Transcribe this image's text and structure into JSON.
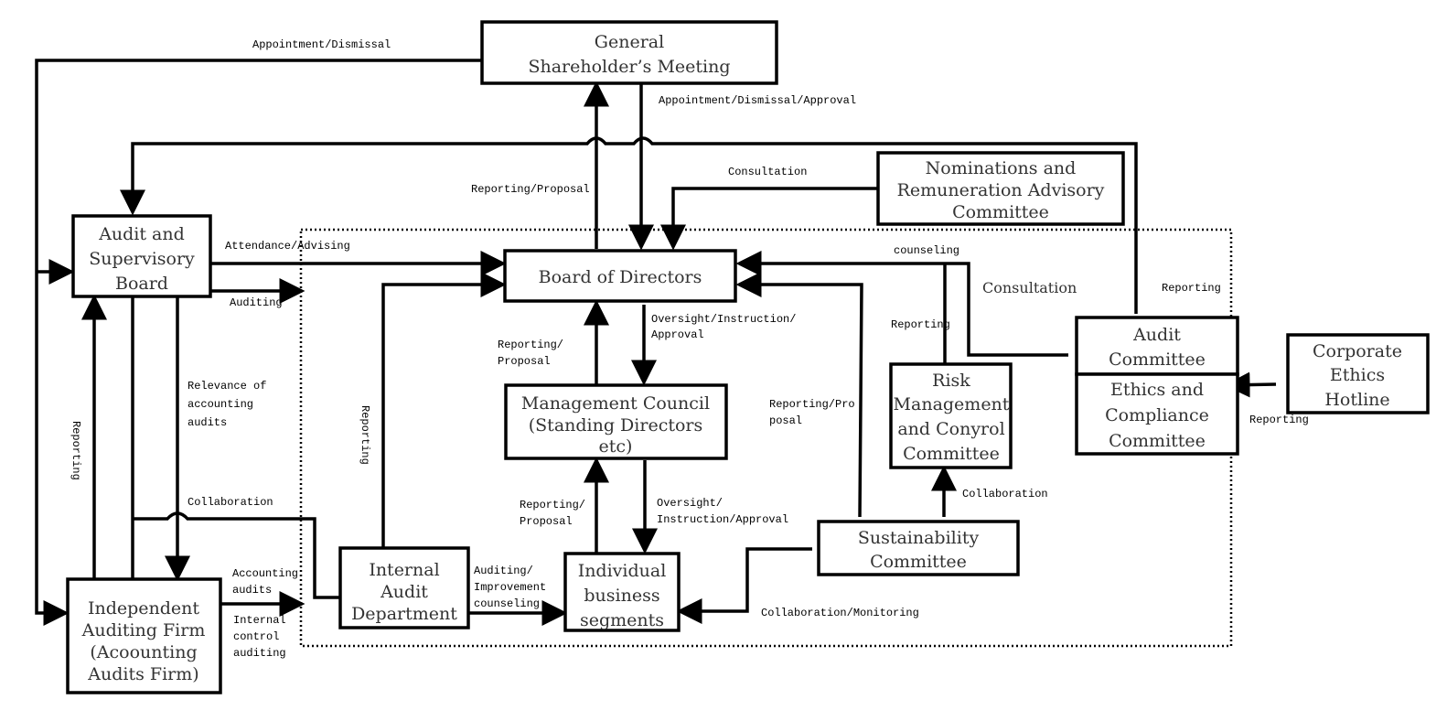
{
  "diagram": {
    "nodes": {
      "gsm": {
        "lines": [
          "General",
          "Shareholder’s Meeting"
        ]
      },
      "nrac": {
        "lines": [
          "Nominations and",
          "Remuneration Advisory",
          "Committee"
        ]
      },
      "asb": {
        "lines": [
          "Audit and",
          "Supervisory",
          "Board"
        ]
      },
      "bod": {
        "lines": [
          "Board of Directors"
        ]
      },
      "mc": {
        "lines": [
          "Management Council",
          "(Standing Directors",
          "etc)"
        ]
      },
      "iad": {
        "lines": [
          "Internal",
          "Audit",
          "Department"
        ]
      },
      "ibs": {
        "lines": [
          "Individual",
          "business",
          "segments"
        ]
      },
      "iaf": {
        "lines": [
          "Independent",
          "Auditing Firm",
          "(Acoounting",
          "Audits Firm)"
        ]
      },
      "rmcc": {
        "lines": [
          "Risk",
          "Management",
          "and Conyrol",
          "Committee"
        ]
      },
      "sc": {
        "lines": [
          "Sustainability",
          "Committee"
        ]
      },
      "ac": {
        "lines": [
          "Audit",
          "Committee"
        ]
      },
      "ecc": {
        "lines": [
          "Ethics and",
          "Compliance",
          "Committee"
        ]
      },
      "ceh": {
        "lines": [
          "Corporate",
          "Ethics",
          "Hotline"
        ]
      }
    },
    "labels": {
      "appointment_dismissal": "Appointment/Dismissal",
      "appointment_dismissal_approval": "Appointment/Dismissal/Approval",
      "reporting_proposal_gsm": "Reporting/Proposal",
      "consultation_nrac": "Consultation",
      "attendance_advising": "Attendance/Advising",
      "auditing": "Auditing",
      "relevance": [
        "Relevance of",
        "accounting",
        "audits"
      ],
      "reporting_iaf": "Reporting",
      "reporting_iad": "Reporting",
      "collaboration_left": "Collaboration",
      "accounting_audits": [
        "Accounting",
        "audits"
      ],
      "internal_control": [
        "Internal",
        "control",
        "auditing"
      ],
      "reporting_proposal_mc": [
        "Reporting/",
        "Proposal"
      ],
      "oversight_mc": [
        "Oversight/Instruction/",
        "Approval"
      ],
      "reporting_proposal_ibs": [
        "Reporting/",
        "Proposal"
      ],
      "oversight_ibs": [
        "Oversight/",
        "Instruction/Approval"
      ],
      "auditing_improvement": [
        "Auditing/",
        "Improvement",
        "counseling"
      ],
      "reporting_proposal_sc": [
        "Reporting/Pro",
        "posal"
      ],
      "collaboration_monitoring": "Collaboration/Monitoring",
      "collaboration_rmcc": "Collaboration",
      "counseling": "counseling",
      "reporting_rmcc": "Reporting",
      "consultation_ac": "Consultation",
      "reporting_ac": "Reporting",
      "reporting_ceh": "Reporting"
    }
  }
}
